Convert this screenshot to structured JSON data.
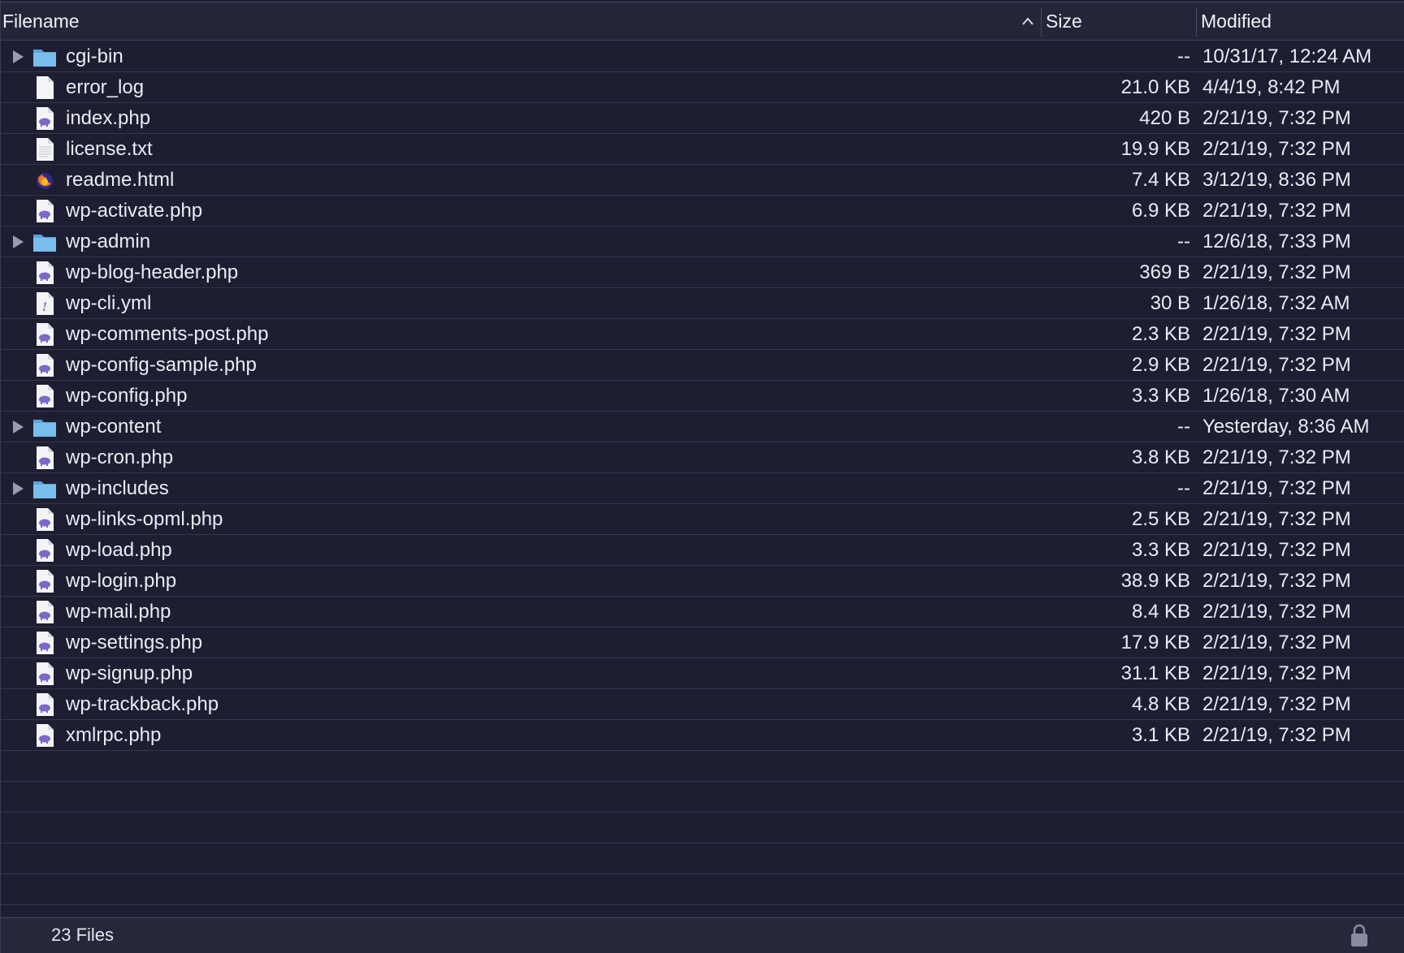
{
  "header": {
    "filename_label": "Filename",
    "size_label": "Size",
    "modified_label": "Modified",
    "sort_icon": "chevron-up-icon"
  },
  "files": [
    {
      "name": "cgi-bin",
      "size": "--",
      "modified": "10/31/17, 12:24 AM",
      "kind": "folder"
    },
    {
      "name": "error_log",
      "size": "21.0 KB",
      "modified": "4/4/19, 8:42 PM",
      "kind": "blank"
    },
    {
      "name": "index.php",
      "size": "420 B",
      "modified": "2/21/19, 7:32 PM",
      "kind": "php"
    },
    {
      "name": "license.txt",
      "size": "19.9 KB",
      "modified": "2/21/19, 7:32 PM",
      "kind": "text"
    },
    {
      "name": "readme.html",
      "size": "7.4 KB",
      "modified": "3/12/19, 8:36 PM",
      "kind": "html"
    },
    {
      "name": "wp-activate.php",
      "size": "6.9 KB",
      "modified": "2/21/19, 7:32 PM",
      "kind": "php"
    },
    {
      "name": "wp-admin",
      "size": "--",
      "modified": "12/6/18, 7:33 PM",
      "kind": "folder"
    },
    {
      "name": "wp-blog-header.php",
      "size": "369 B",
      "modified": "2/21/19, 7:32 PM",
      "kind": "php"
    },
    {
      "name": "wp-cli.yml",
      "size": "30 B",
      "modified": "1/26/18, 7:32 AM",
      "kind": "yml"
    },
    {
      "name": "wp-comments-post.php",
      "size": "2.3 KB",
      "modified": "2/21/19, 7:32 PM",
      "kind": "php"
    },
    {
      "name": "wp-config-sample.php",
      "size": "2.9 KB",
      "modified": "2/21/19, 7:32 PM",
      "kind": "php"
    },
    {
      "name": "wp-config.php",
      "size": "3.3 KB",
      "modified": "1/26/18, 7:30 AM",
      "kind": "php"
    },
    {
      "name": "wp-content",
      "size": "--",
      "modified": "Yesterday, 8:36 AM",
      "kind": "folder"
    },
    {
      "name": "wp-cron.php",
      "size": "3.8 KB",
      "modified": "2/21/19, 7:32 PM",
      "kind": "php"
    },
    {
      "name": "wp-includes",
      "size": "--",
      "modified": "2/21/19, 7:32 PM",
      "kind": "folder"
    },
    {
      "name": "wp-links-opml.php",
      "size": "2.5 KB",
      "modified": "2/21/19, 7:32 PM",
      "kind": "php"
    },
    {
      "name": "wp-load.php",
      "size": "3.3 KB",
      "modified": "2/21/19, 7:32 PM",
      "kind": "php"
    },
    {
      "name": "wp-login.php",
      "size": "38.9 KB",
      "modified": "2/21/19, 7:32 PM",
      "kind": "php"
    },
    {
      "name": "wp-mail.php",
      "size": "8.4 KB",
      "modified": "2/21/19, 7:32 PM",
      "kind": "php"
    },
    {
      "name": "wp-settings.php",
      "size": "17.9 KB",
      "modified": "2/21/19, 7:32 PM",
      "kind": "php"
    },
    {
      "name": "wp-signup.php",
      "size": "31.1 KB",
      "modified": "2/21/19, 7:32 PM",
      "kind": "php"
    },
    {
      "name": "wp-trackback.php",
      "size": "4.8 KB",
      "modified": "2/21/19, 7:32 PM",
      "kind": "php"
    },
    {
      "name": "xmlrpc.php",
      "size": "3.1 KB",
      "modified": "2/21/19, 7:32 PM",
      "kind": "php"
    }
  ],
  "footer": {
    "count_label": "23 Files",
    "lock_icon": "lock-icon"
  },
  "colors": {
    "background": "#1d1e32",
    "header": "#242538",
    "folder": "#6fb3e6",
    "php_badge": "#7b68c8",
    "text": "#ebebf2"
  }
}
